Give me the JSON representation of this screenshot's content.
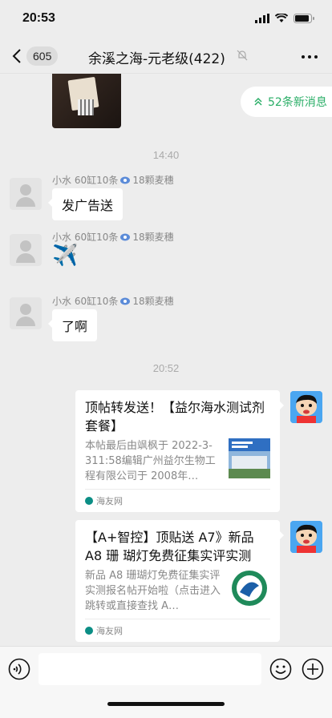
{
  "status_bar": {
    "time": "20:53"
  },
  "nav": {
    "unread_count": "605",
    "title": "余溪之海-元老级(422)"
  },
  "new_messages": {
    "label": "52条新消息"
  },
  "messages": {
    "time1": "14:40",
    "m1": {
      "sender": "小水 60缸10条 ",
      "sender_suffix": "18颗麦穗",
      "text": "发广告送"
    },
    "m2": {
      "sender": "小水 60缸10条 ",
      "sender_suffix": "18颗麦穗",
      "emoji": "✈️"
    },
    "m3": {
      "sender": "小水 60缸10条 ",
      "sender_suffix": "18颗麦穗",
      "text": "了啊"
    },
    "time2": "20:52",
    "card1": {
      "title": "顶帖转发送！【益尔海水测试剂套餐】",
      "desc": "本帖最后由飒枫于 2022-3-311:58编辑广州益尔生物工程有限公司于 2008年…",
      "source": "海友网"
    },
    "card2": {
      "title": "【A+智控】顶贴送 A7》新品A8 珊 瑚灯免费征集实评实测",
      "desc": "新品 A8 珊瑚灯免费征集实评实测报名帖开始啦（点击进入跳转或直接查找 A…",
      "source": "海友网"
    }
  },
  "input": {
    "placeholder": ""
  },
  "colors": {
    "accent": "#2aae67",
    "background": "#ededed"
  }
}
